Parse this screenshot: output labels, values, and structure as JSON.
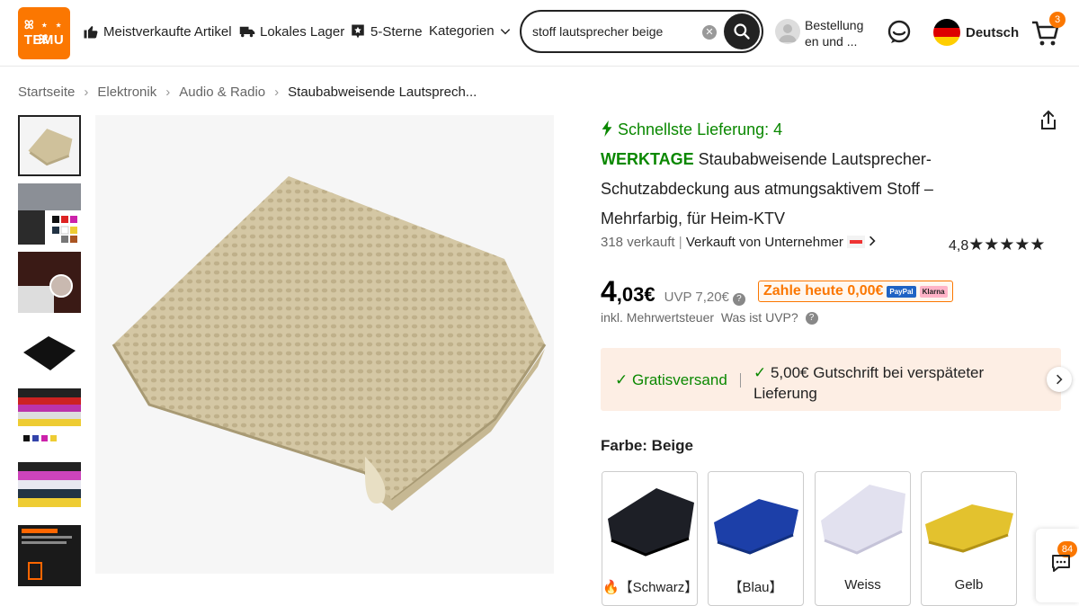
{
  "header": {
    "logo_line1": "ꕤ ⋆ ⋆ ꕤ",
    "logo_line2": "TEMU",
    "nav": {
      "bestsellers": "Meistverkaufte Artikel",
      "local_warehouse": "Lokales Lager",
      "five_stars": "5-Sterne",
      "categories": "Kategorien"
    },
    "search": {
      "value": "stoff lautsprecher beige"
    },
    "orders_line1": "Bestellung",
    "orders_line2": "en und ...",
    "language": "Deutsch",
    "cart_count": "3",
    "accent_color": "#fb7701"
  },
  "breadcrumb": {
    "items": [
      "Startseite",
      "Elektronik",
      "Audio & Radio",
      "Staubabweisende Lautsprech..."
    ]
  },
  "product": {
    "delivery_label": "Schnellste Lieferung: 4",
    "delivery_label2": "WERKTAGE",
    "title": " Staubabweisende Lautsprecher-Schutzabdeckung aus atmungsaktivem Stoff – Mehrfarbig, für Heim-KTV",
    "sold": "318 verkauft",
    "seller": "Verkauft von Unternehmer",
    "rating": "4,8",
    "stars": "★★★★★",
    "price_int": "4",
    "price_dec": ",03€",
    "uvp": "UVP 7,20€",
    "pay_today": "Zahle heute 0,00€",
    "paypal": "PayPal",
    "klarna": "Klarna",
    "tax": "inkl. Mehrwertsteuer",
    "what_uvp": "Was ist UVP?",
    "benefit1": "✓ Gratisversand",
    "benefit2_check": "✓",
    "benefit2": " 5,00€ Gutschrift bei verspäteter Lieferung",
    "color_label": "Farbe: Beige",
    "colors": [
      {
        "name": "🔥【Schwarz】",
        "hex": "#1d1f26"
      },
      {
        "name": "【Blau】",
        "hex": "#1c3fa8"
      },
      {
        "name": "Weiss",
        "hex": "#e2e1ef"
      },
      {
        "name": "Gelb",
        "hex": "#e3c22e"
      }
    ]
  },
  "support_badge": "84"
}
